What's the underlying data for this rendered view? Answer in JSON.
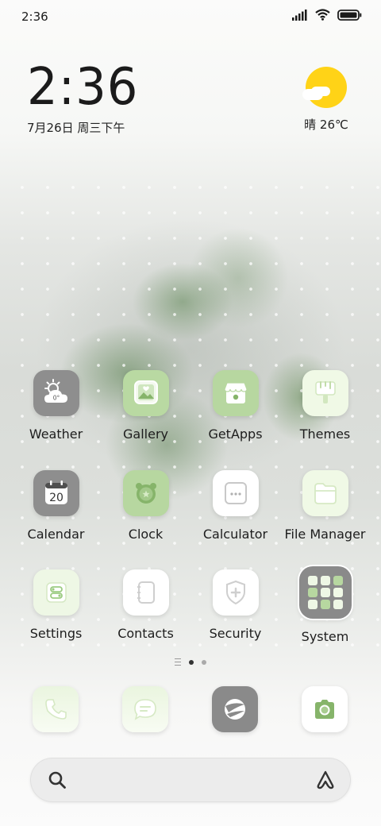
{
  "status_bar": {
    "time": "2:36",
    "icons": [
      "signal-icon",
      "wifi-icon",
      "battery-icon"
    ]
  },
  "clock_widget": {
    "time": "2:36",
    "date": "7月26日 周三下午"
  },
  "weather_widget": {
    "icon": "sunny-cloud-icon",
    "text": "晴 26℃"
  },
  "apps": [
    {
      "label": "Weather",
      "icon": "weather-icon",
      "badge": "0°"
    },
    {
      "label": "Gallery",
      "icon": "gallery-icon"
    },
    {
      "label": "GetApps",
      "icon": "getapps-icon"
    },
    {
      "label": "Themes",
      "icon": "themes-icon"
    },
    {
      "label": "Calendar",
      "icon": "calendar-icon",
      "badge": "20"
    },
    {
      "label": "Clock",
      "icon": "clock-icon"
    },
    {
      "label": "Calculator",
      "icon": "calculator-icon"
    },
    {
      "label": "File Manager",
      "icon": "file-manager-icon"
    },
    {
      "label": "Settings",
      "icon": "settings-icon"
    },
    {
      "label": "Contacts",
      "icon": "contacts-icon"
    },
    {
      "label": "Security",
      "icon": "security-icon"
    },
    {
      "label": "System",
      "icon": "system-folder-icon"
    }
  ],
  "dock": [
    {
      "icon": "phone-icon"
    },
    {
      "icon": "messages-icon"
    },
    {
      "icon": "browser-icon"
    },
    {
      "icon": "camera-icon"
    }
  ],
  "page_indicator": {
    "pages": 2,
    "active": 1
  },
  "search_bar": {
    "icon": "search-icon",
    "assistant_icon": "assistant-icon"
  },
  "colors": {
    "sun": "#ffd317",
    "accent_green": "#86b46a",
    "icon_gray": "#8d8d8d"
  }
}
